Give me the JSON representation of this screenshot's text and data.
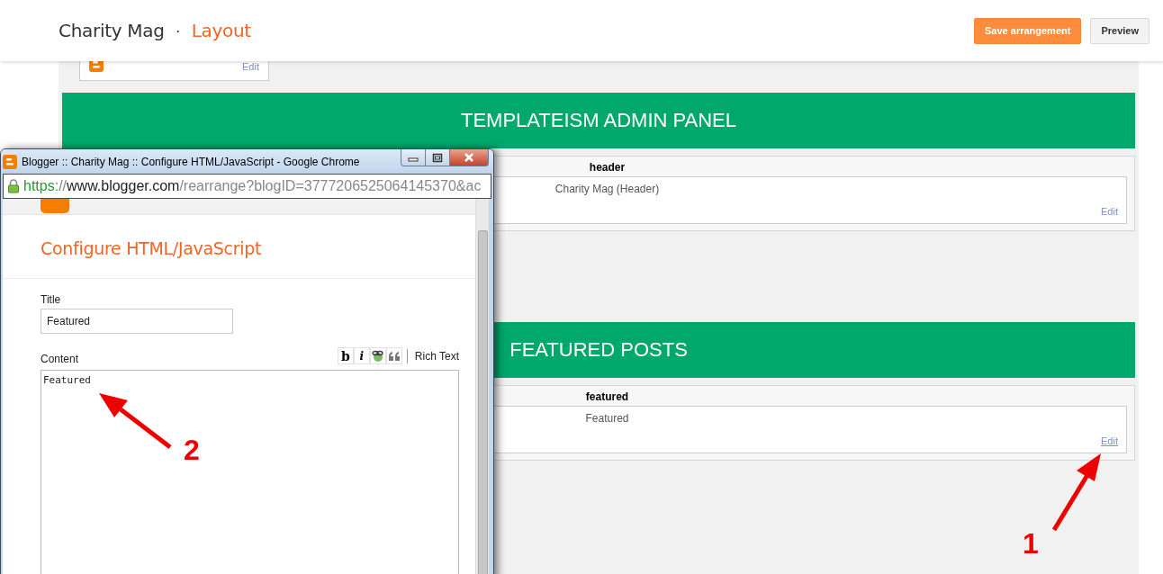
{
  "header": {
    "blog_name": "Charity Mag",
    "separator": "·",
    "page": "Layout",
    "buttons": [
      {
        "label": "Save arrangement",
        "kind": "primary"
      },
      {
        "label": "Preview",
        "kind": "secondary"
      }
    ]
  },
  "layout": {
    "top_widget": {
      "edit_link": "Edit"
    },
    "sections": [
      {
        "banner": "TEMPLATEISM ADMIN PANEL",
        "section_id": "header",
        "widgets": [
          {
            "title": "Charity Mag (Header)",
            "edit_link": "Edit",
            "hovered": false
          }
        ]
      },
      {
        "banner": "FEATURED POSTS",
        "section_id": "featured",
        "widgets": [
          {
            "title": "Featured",
            "edit_link": "Edit",
            "hovered": true
          }
        ]
      }
    ]
  },
  "popup": {
    "title": "Blogger :: Charity Mag :: Configure HTML/JavaScript - Google Chrome",
    "url": {
      "scheme": "https",
      "separator": "://",
      "host": "www.blogger.com",
      "path": "/rearrange?blogID=3777206525064145370&ac"
    },
    "heading": "Configure HTML/JavaScript",
    "title_label": "Title",
    "title_value": "Featured",
    "content_label": "Content",
    "toolbar": [
      {
        "kind": "text",
        "label": "b"
      },
      {
        "kind": "text",
        "label": "i"
      },
      {
        "kind": "link"
      },
      {
        "kind": "quote"
      }
    ],
    "rich_text": "Rich Text",
    "content_value": "Featured"
  },
  "annotations": [
    {
      "label": "1"
    },
    {
      "label": "2"
    }
  ]
}
